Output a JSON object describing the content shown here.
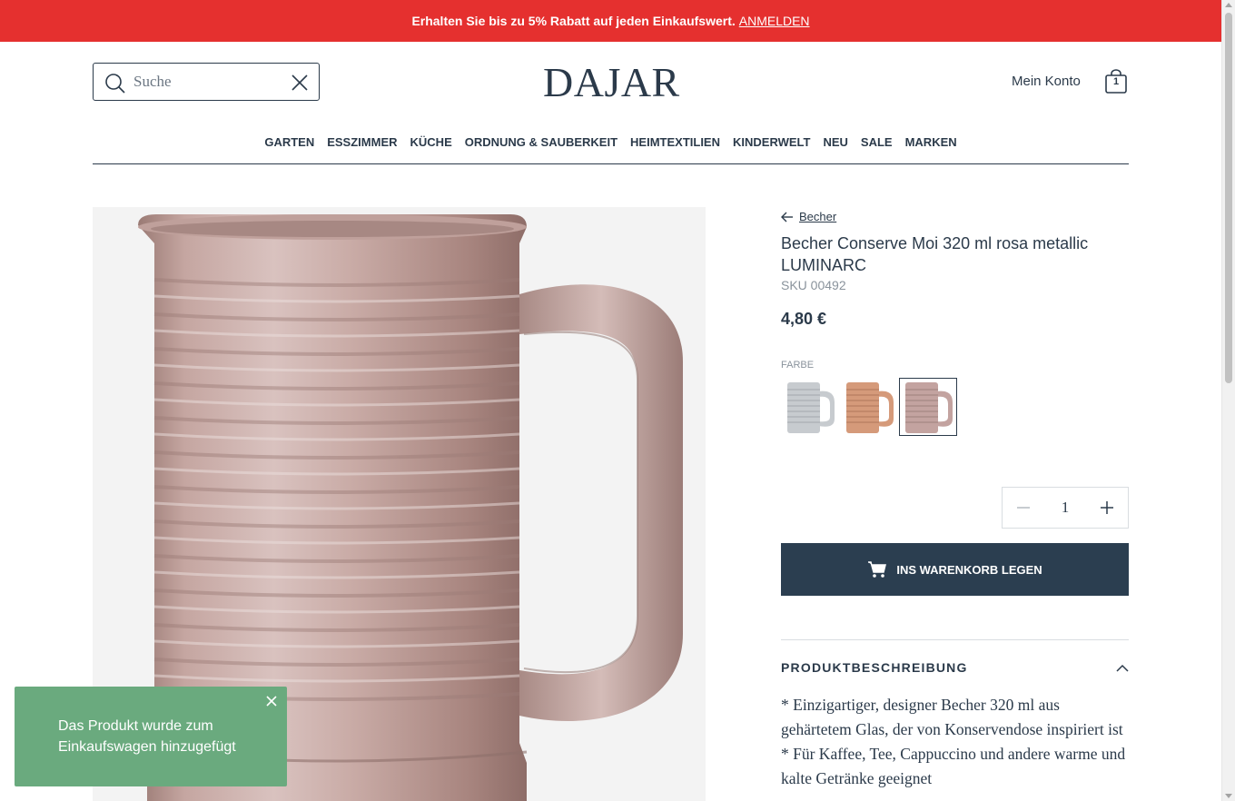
{
  "promo": {
    "text": "Erhalten Sie bis zu 5% Rabatt auf jeden Einkaufswert.",
    "link": "ANMELDEN"
  },
  "header": {
    "search_placeholder": "Suche",
    "logo": "DAJAR",
    "account_label": "Mein Konto",
    "cart_count": "1"
  },
  "nav": [
    {
      "label": "GARTEN"
    },
    {
      "label": "ESSZIMMER"
    },
    {
      "label": "KÜCHE"
    },
    {
      "label": "ORDNUNG & SAUBERKEIT"
    },
    {
      "label": "HEIMTEXTILIEN"
    },
    {
      "label": "KINDERWELT"
    },
    {
      "label": "NEU"
    },
    {
      "label": "SALE"
    },
    {
      "label": "MARKEN"
    }
  ],
  "product": {
    "breadcrumb": "Becher",
    "title": "Becher Conserve Moi 320 ml rosa metallic LUMINARC",
    "sku": "SKU 00492",
    "price": "4,80 €",
    "color_label": "FARBE",
    "swatches": [
      {
        "name": "silver",
        "color": "#c7cbcf"
      },
      {
        "name": "copper",
        "color": "#d59a7a"
      },
      {
        "name": "rose",
        "color": "#c3a3a0",
        "selected": true
      }
    ],
    "quantity": "1",
    "add_to_cart": "INS WARENKORB LEGEN",
    "description_heading": "PRODUKTBESCHREIBUNG",
    "description_lines": [
      "* Einzigartiger, designer Becher 320 ml aus gehärtetem Glas, der von Konservendose inspiriert ist",
      "* Für Kaffee, Tee, Cappuccino und andere warme und kalte Getränke geeignet"
    ]
  },
  "toast": {
    "message": "Das Produkt wurde zum Einkaufswagen hinzugefügt"
  },
  "colors": {
    "promo_bg": "#e5302f",
    "primary": "#2b3e50",
    "toast_bg": "#6aaa7e"
  }
}
